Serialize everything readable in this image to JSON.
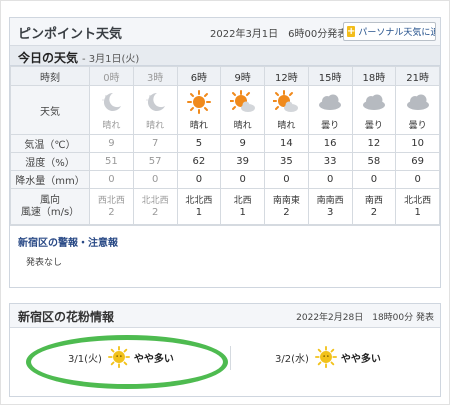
{
  "header": {
    "title": "ピンポイント天気",
    "issued": "2022年3月1日　6時00分発表",
    "add_button": "パーソナル天気に追加",
    "add_icon": "plus-icon"
  },
  "today": {
    "title": "今日の天気",
    "date": "- 3月1日(火)"
  },
  "table": {
    "labels": {
      "time": "時刻",
      "weather": "天気",
      "temp": "気温（℃）",
      "humidity": "湿度（%）",
      "precip": "降水量（mm）",
      "wind": "風向\n風速（m/s）"
    },
    "hours": [
      "0時",
      "3時",
      "6時",
      "9時",
      "12時",
      "15時",
      "18時",
      "21時"
    ],
    "weather": [
      {
        "label": "晴れ",
        "icon": "moon-icon"
      },
      {
        "label": "晴れ",
        "icon": "moon-icon"
      },
      {
        "label": "晴れ",
        "icon": "sun-icon"
      },
      {
        "label": "晴れ",
        "icon": "sun-cloud-icon"
      },
      {
        "label": "晴れ",
        "icon": "sun-cloud-icon"
      },
      {
        "label": "曇り",
        "icon": "cloud-icon"
      },
      {
        "label": "曇り",
        "icon": "cloud-icon"
      },
      {
        "label": "曇り",
        "icon": "cloud-icon"
      }
    ],
    "temp": [
      "9",
      "7",
      "5",
      "9",
      "14",
      "16",
      "12",
      "10"
    ],
    "humidity": [
      "51",
      "57",
      "62",
      "39",
      "35",
      "33",
      "58",
      "69"
    ],
    "precip": [
      "0",
      "0",
      "0",
      "0",
      "0",
      "0",
      "0",
      "0"
    ],
    "wind_dir": [
      "西北西",
      "北北西",
      "北北西",
      "北西",
      "南南東",
      "南南西",
      "南西",
      "北北西"
    ],
    "wind_speed": [
      "2",
      "2",
      "1",
      "1",
      "2",
      "3",
      "2",
      "1"
    ]
  },
  "alerts": {
    "title": "新宿区の警報・注意報",
    "body": "発表なし"
  },
  "pollen": {
    "title": "新宿区の花粉情報",
    "issued": "2022年2月28日　18時00分 発表",
    "days": [
      {
        "date": "3/1(火)",
        "level": "やや多い",
        "icon": "sun-face-icon"
      },
      {
        "date": "3/2(水)",
        "level": "やや多い",
        "icon": "sun-face-icon"
      }
    ]
  },
  "colors": {
    "highlight": "#4ebb50",
    "sun": "#f08a1c",
    "accent_button": "#f3bd1a",
    "link": "#2a4a86"
  }
}
